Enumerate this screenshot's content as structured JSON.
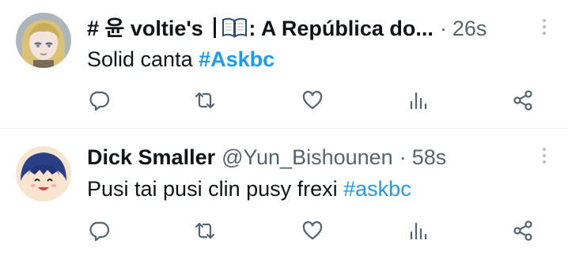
{
  "tweets": [
    {
      "name_prefix": "# 윤 voltie's ",
      "name_suffix": ": A República do...",
      "time": "26s",
      "text": "Solid canta ",
      "hashtag": "#Askbc",
      "avatar": "anime-avatar-blonde-hair"
    },
    {
      "name": "Dick Smaller",
      "handle": "@Yun_Bishounen",
      "time": "58s",
      "text": "Pusi tai pusi clin pusy frexi ",
      "hashtag": "#askbc",
      "avatar": "anime-avatar-smiling-boy"
    }
  ],
  "icons": {
    "reply": "reply-icon",
    "retweet": "retweet-icon",
    "like": "like-icon",
    "views": "views-icon",
    "share": "share-icon",
    "more": "more-icon",
    "book": "open-book-emoji"
  },
  "colors": {
    "text": "#0f1419",
    "secondary": "#536471",
    "hashtag": "#1d9bf0",
    "divider": "#eff3f4"
  }
}
